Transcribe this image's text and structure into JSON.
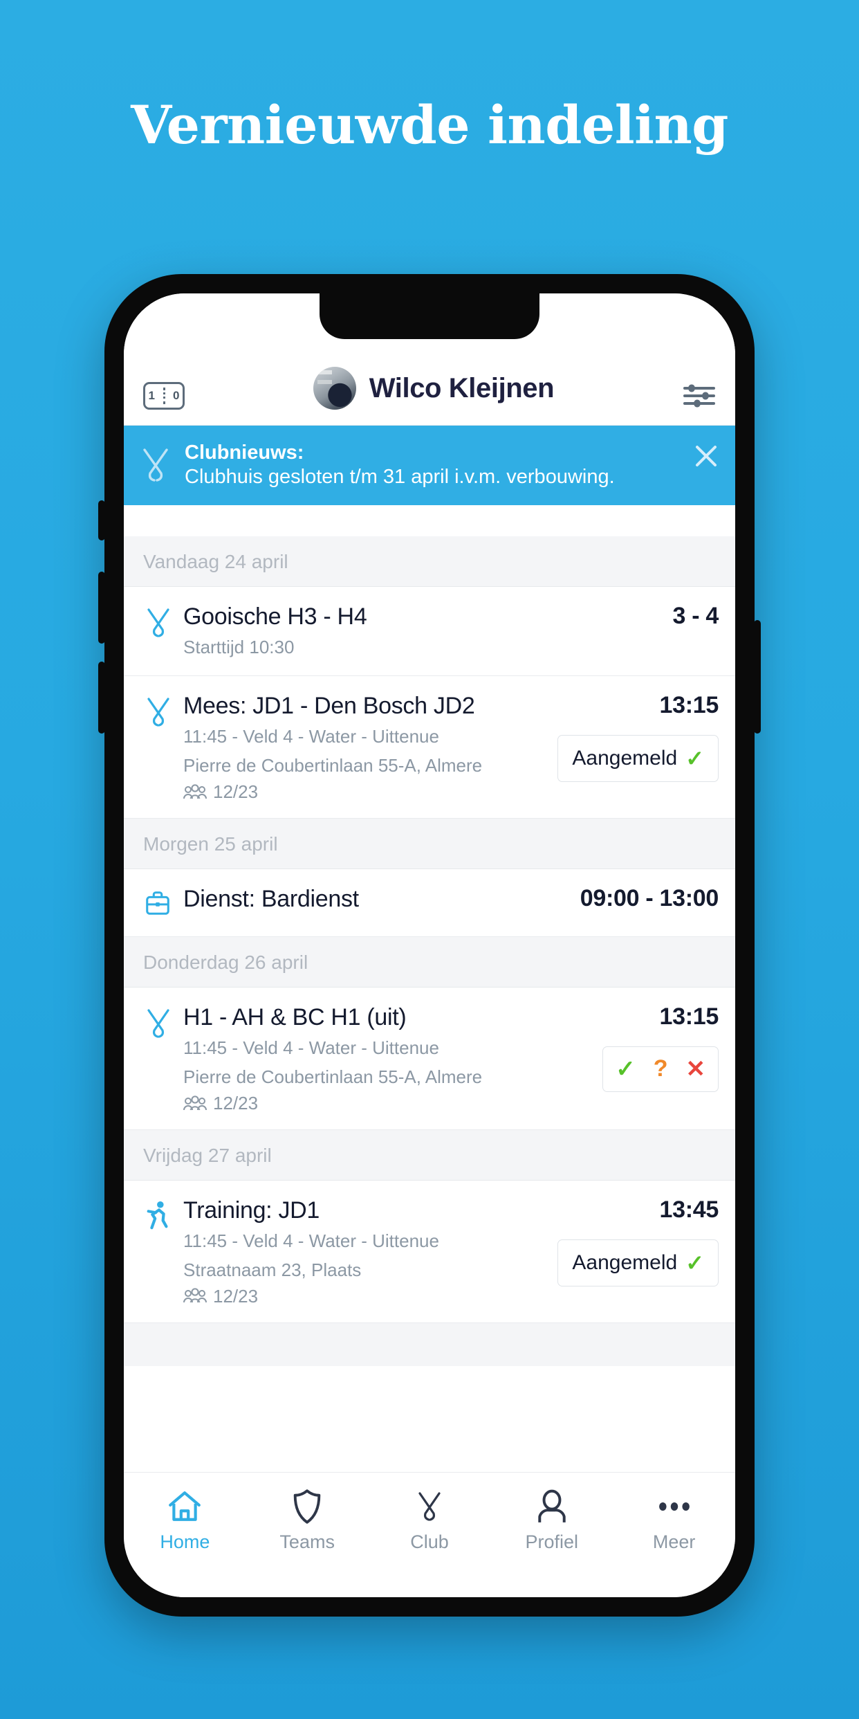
{
  "poster": {
    "headline": "Vernieuwde indeling"
  },
  "app_header": {
    "score_icon_left": "1",
    "score_icon_right": "0",
    "user_name": "Wilco Kleijnen",
    "score_icon_name": "scoreboard-icon",
    "filter_icon_name": "filter-sliders-icon"
  },
  "banner": {
    "title": "Clubnieuws:",
    "body": "Clubhuis gesloten t/m 31 april i.v.m. verbouwing.",
    "close_label": "✕",
    "bg_color": "#30AEE4"
  },
  "sections": [
    {
      "day": "Vandaag 24 april",
      "events": [
        {
          "icon": "hockey-sticks-icon",
          "title": "Gooische H3 - H4",
          "sub1": "Starttijd 10:30",
          "sub2": "",
          "attendance": "",
          "right_value": "3 - 4",
          "action": "none"
        },
        {
          "icon": "hockey-sticks-icon",
          "title": "Mees: JD1 - Den Bosch JD2",
          "sub1": "11:45 - Veld 4 - Water - Uittenue",
          "sub2": "Pierre de Coubertinlaan 55-A, Almere",
          "attendance": "12/23",
          "right_value": "13:15",
          "action": "pill",
          "pill_label": "Aangemeld"
        }
      ]
    },
    {
      "day": "Morgen 25 april",
      "events": [
        {
          "icon": "briefcase-icon",
          "title": "Dienst: Bardienst",
          "sub1": "",
          "sub2": "",
          "attendance": "",
          "right_value": "09:00 - 13:00",
          "action": "none"
        }
      ]
    },
    {
      "day": "Donderdag 26 april",
      "events": [
        {
          "icon": "hockey-sticks-icon",
          "title": "H1 - AH & BC H1 (uit)",
          "sub1": "11:45 - Veld 4 - Water - Uittenue",
          "sub2": "Pierre de Coubertinlaan 55-A, Almere",
          "attendance": "12/23",
          "right_value": "13:15",
          "action": "choice",
          "choice_yes": "✓",
          "choice_maybe": "?",
          "choice_no": "✕"
        }
      ]
    },
    {
      "day": "Vrijdag 27 april",
      "events": [
        {
          "icon": "running-person-icon",
          "title": "Training: JD1",
          "sub1": "11:45 - Veld 4 - Water - Uittenue",
          "sub2": "Straatnaam 23, Plaats",
          "attendance": "12/23",
          "right_value": "13:45",
          "action": "pill",
          "pill_label": "Aangemeld"
        }
      ]
    }
  ],
  "tabbar": {
    "items": [
      {
        "label": "Home",
        "icon": "home-icon",
        "active": true
      },
      {
        "label": "Teams",
        "icon": "shield-icon",
        "active": false
      },
      {
        "label": "Club",
        "icon": "hockey-sticks-icon",
        "active": false
      },
      {
        "label": "Profiel",
        "icon": "person-icon",
        "active": false
      },
      {
        "label": "Meer",
        "icon": "ellipsis-icon",
        "active": false
      }
    ]
  },
  "colors": {
    "accent": "#30AEE4",
    "text_dark": "#141a2e",
    "text_muted": "#8c98a4",
    "green": "#57c12a",
    "orange": "#f0892a",
    "red": "#e8453c"
  }
}
